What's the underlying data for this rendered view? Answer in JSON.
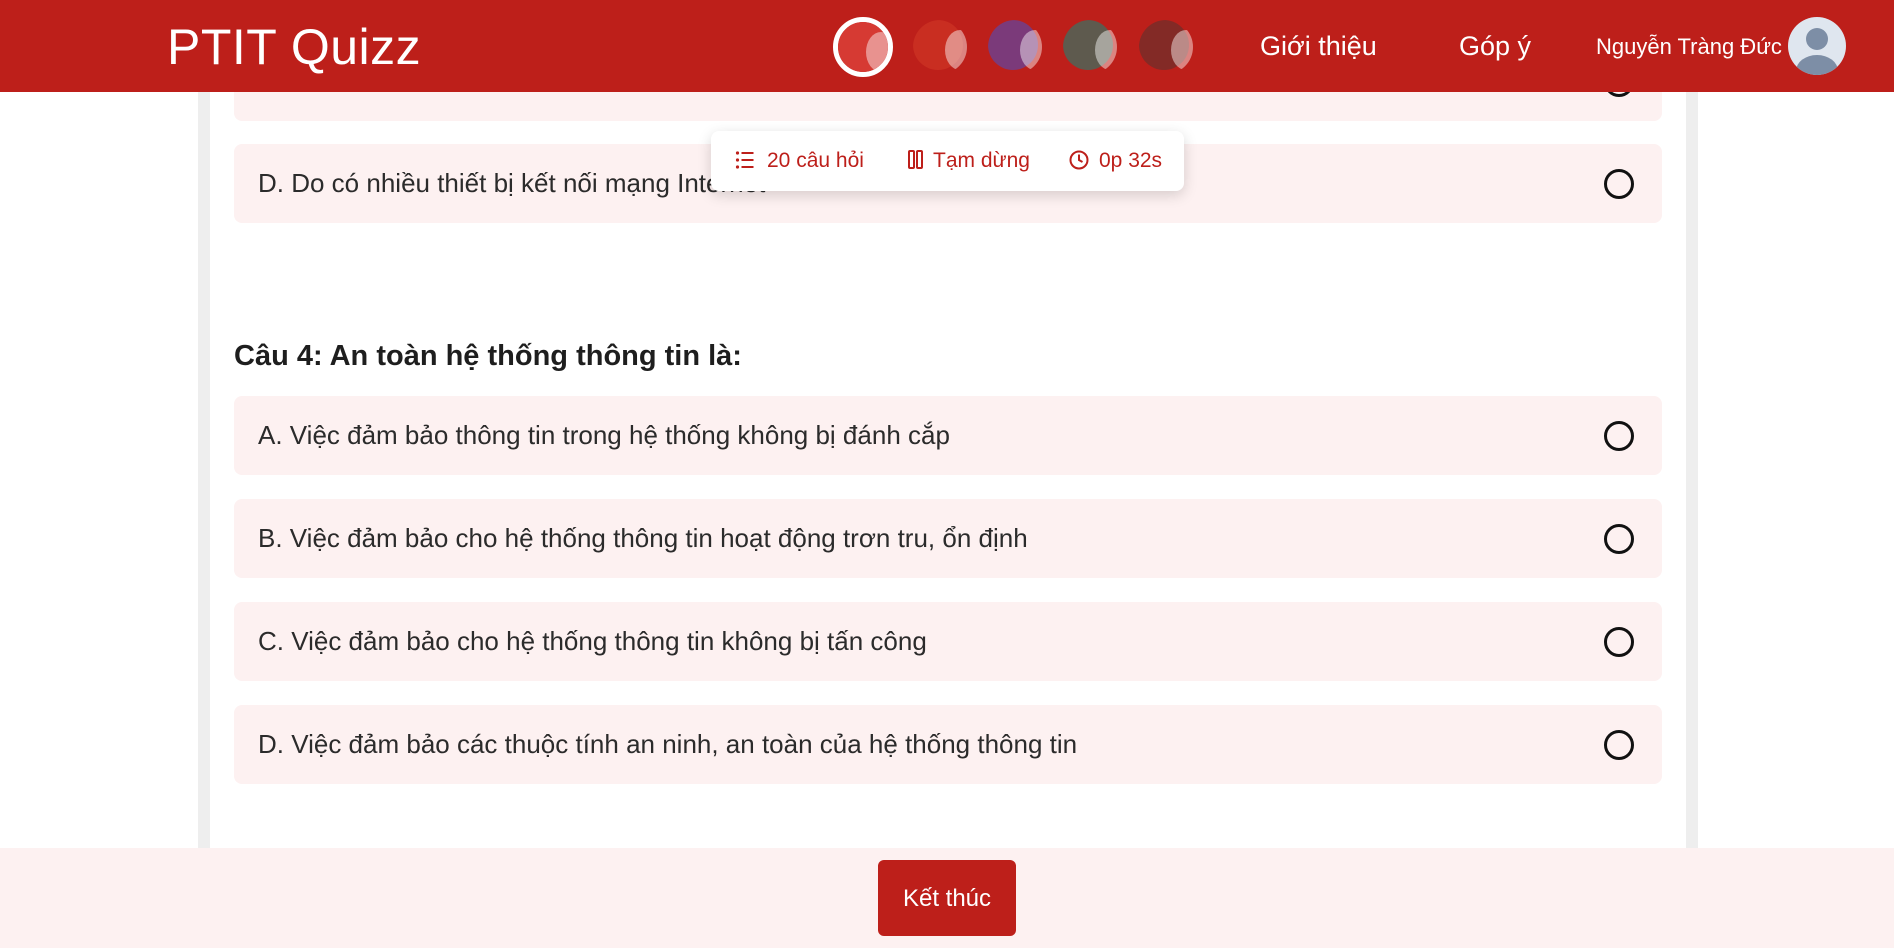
{
  "app": {
    "title": "PTIT Quizz"
  },
  "header": {
    "themes": [
      {
        "name": "red-theme",
        "color": "#d63a33",
        "active": true
      },
      {
        "name": "red-theme-2",
        "color": "#c92e21"
      },
      {
        "name": "purple-theme",
        "color": "#7b3a7a"
      },
      {
        "name": "gray-theme",
        "color": "#5e5a4e"
      },
      {
        "name": "maroon-theme",
        "color": "#832a26"
      }
    ],
    "nav": {
      "about": "Giới thiệu",
      "feedback": "Góp ý"
    },
    "user": {
      "name": "Nguyễn Tràng Đức"
    }
  },
  "toolbar": {
    "questions": "20 câu hỏi",
    "pause": "Tạm dừng",
    "timer": "0p 32s"
  },
  "previous_question": {
    "options": [
      {
        "label": "D. Do có nhiều thiết bị kết nối mạng Internet"
      }
    ]
  },
  "question": {
    "title": "Câu 4: An toàn hệ thống thông tin là:",
    "options": [
      {
        "label": "A. Việc đảm bảo thông tin trong hệ thống không bị đánh cắp"
      },
      {
        "label": "B. Việc đảm bảo cho hệ thống thông tin hoạt động trơn tru, ổn định"
      },
      {
        "label": "C. Việc đảm bảo cho hệ thống thông tin không bị tấn công"
      },
      {
        "label": "D. Việc đảm bảo các thuộc tính an ninh, an toàn của hệ thống thông tin"
      }
    ]
  },
  "footer": {
    "finish_label": "Kết thúc"
  },
  "colors": {
    "brand": "#bd1f1a",
    "option_bg": "#fdf1f1"
  }
}
